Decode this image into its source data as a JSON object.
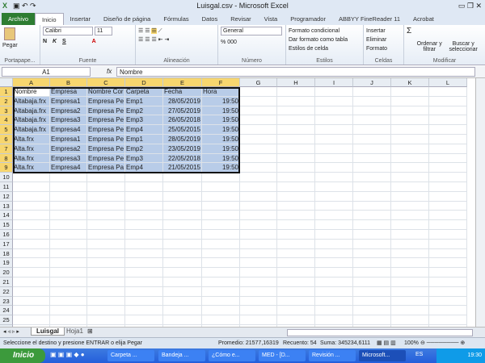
{
  "window": {
    "title": "Luisgal.csv - Microsoft Excel"
  },
  "tabs": [
    "Archivo",
    "Inicio",
    "Insertar",
    "Diseño de página",
    "Fórmulas",
    "Datos",
    "Revisar",
    "Vista",
    "Programador",
    "ABBYY FineReader 11",
    "Acrobat"
  ],
  "ribbon": {
    "clipboard": {
      "paste": "Pegar",
      "label": "Portapape..."
    },
    "font": {
      "name": "Calibri",
      "size": "11",
      "bold": "N",
      "italic": "K",
      "underline": "S",
      "label": "Fuente"
    },
    "alignment": {
      "label": "Alineación"
    },
    "number": {
      "format": "General",
      "percent": "%",
      "thousands": "000",
      "label": "Número"
    },
    "styles": {
      "conditional": "Formato condicional",
      "table": "Dar formato como tabla",
      "cell": "Estilos de celda",
      "label": "Estilos"
    },
    "cells": {
      "insert": "Insertar",
      "delete": "Eliminar",
      "format": "Formato",
      "label": "Celdas"
    },
    "editing": {
      "sum": "Σ",
      "sort": "Ordenar y filtrar",
      "find": "Buscar y seleccionar",
      "label": "Modificar"
    }
  },
  "formula_bar": {
    "name_box": "A1",
    "fx": "fx",
    "value": "Nombre"
  },
  "columns": [
    "A",
    "B",
    "C",
    "D",
    "E",
    "F",
    "G",
    "H",
    "I",
    "J",
    "K",
    "L"
  ],
  "rows": [
    [
      "Nombre",
      "Empresa",
      "Nombre Cor",
      "Carpeta",
      "Fecha",
      "Hora"
    ],
    [
      "Altabaja.frx",
      "Empresa1",
      "Empresa Pe",
      "Emp1",
      "28/05/2019",
      "19:50"
    ],
    [
      "Altabaja.frx",
      "Empresa2",
      "Empresa Pe",
      "Emp2",
      "27/05/2019",
      "19:50"
    ],
    [
      "Altabaja.frx",
      "Empresa3",
      "Empresa Pe",
      "Emp3",
      "26/05/2018",
      "19:50"
    ],
    [
      "Altabaja.frx",
      "Empresa4",
      "Empresa Pe",
      "Emp4",
      "25/05/2015",
      "19:50"
    ],
    [
      "Alta.frx",
      "Empresa1",
      "Empresa Pe",
      "Emp1",
      "28/05/2019",
      "19:50"
    ],
    [
      "Alta.frx",
      "Empresa2",
      "Empresa Pe",
      "Emp2",
      "23/05/2019",
      "19:50"
    ],
    [
      "Alta.frx",
      "Empresa3",
      "Empresa Pe",
      "Emp3",
      "22/05/2018",
      "19:50"
    ],
    [
      "Alta.frx",
      "Empresa4",
      "Empresa Pa",
      "Emp4",
      "21/05/2015",
      "19:50"
    ]
  ],
  "row_count": 26,
  "sheets": [
    "Luisgal",
    "Hoja1"
  ],
  "status": {
    "message": "Seleccione el destino y presione ENTRAR o elija Pegar",
    "average": "Promedio: 21577,16319",
    "count": "Recuento: 54",
    "sum": "Suma: 345234,6111",
    "zoom": "100%"
  },
  "taskbar": {
    "start": "Inicio",
    "items": [
      "Carpeta ...",
      "Bandeja ...",
      "¿Cómo e...",
      "MED - [D...",
      "Revisión ...",
      "Microsoft..."
    ],
    "lang": "ES",
    "clock": "19:30"
  }
}
